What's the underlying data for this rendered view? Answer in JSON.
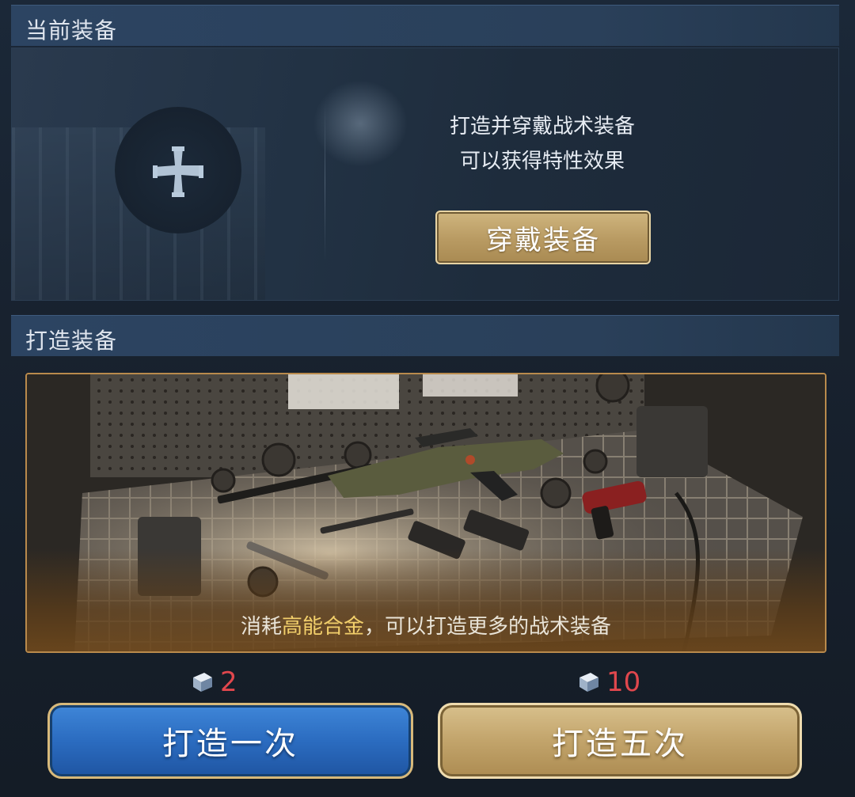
{
  "current_equipment": {
    "header": "当前装备",
    "info_line1": "打造并穿戴战术装备",
    "info_line2": "可以获得特性效果",
    "wear_button": "穿戴装备",
    "add_slot_icon": "plus-cross-icon"
  },
  "forge": {
    "header": "打造装备",
    "desc_prefix": "消耗",
    "desc_highlight": "高能合金",
    "desc_suffix": "，可以打造更多的战术装备",
    "once": {
      "cost": "2",
      "label": "打造一次"
    },
    "five": {
      "cost": "10",
      "label": "打造五次"
    },
    "cost_icon": "alloy-ingot-icon"
  },
  "colors": {
    "highlight": "#f2cf6b",
    "cost": "#e0474d",
    "blue_button": "#2b6cc0",
    "gold_button": "#c2a46b"
  }
}
